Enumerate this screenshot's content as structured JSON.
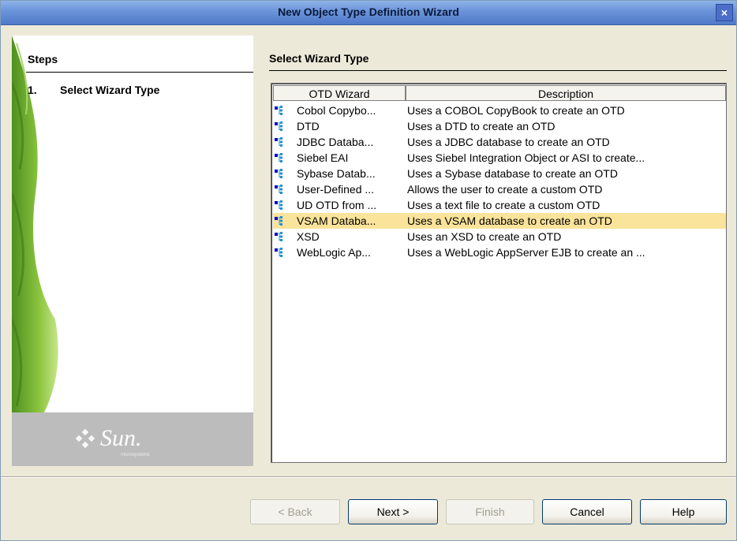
{
  "window": {
    "title": "New Object Type Definition Wizard",
    "close_glyph": "×"
  },
  "steps": {
    "title": "Steps",
    "items": [
      {
        "number": "1.",
        "label": "Select Wizard Type"
      }
    ]
  },
  "brand": {
    "name": "Sun.",
    "sub": "microsystems"
  },
  "main": {
    "title": "Select Wizard Type"
  },
  "table": {
    "columns": [
      "OTD Wizard",
      "Description"
    ],
    "rows": [
      {
        "name": "Cobol Copybo...",
        "description": "Uses a COBOL CopyBook to create an OTD"
      },
      {
        "name": "DTD",
        "description": "Uses a DTD to create an OTD"
      },
      {
        "name": "JDBC Databa...",
        "description": "Uses a JDBC database to create an OTD"
      },
      {
        "name": "Siebel EAI",
        "description": "Uses Siebel Integration Object or ASI to create..."
      },
      {
        "name": "Sybase Datab...",
        "description": "Uses a Sybase database to create an OTD"
      },
      {
        "name": "User-Defined ...",
        "description": "Allows the user to create a custom OTD"
      },
      {
        "name": "UD OTD from ...",
        "description": "Uses a text file to create a custom OTD"
      },
      {
        "name": "VSAM Databa...",
        "description": "Uses a VSAM database to create an OTD"
      },
      {
        "name": "XSD",
        "description": "Uses an XSD to create an OTD"
      },
      {
        "name": "WebLogic Ap...",
        "description": "Uses a WebLogic AppServer EJB to create an ..."
      }
    ],
    "selected_row": "VSAM Databa...",
    "row_icon": "otd-tree-icon"
  },
  "buttons": {
    "back": "< Back",
    "next": "Next >",
    "finish": "Finish",
    "cancel": "Cancel",
    "help": "Help"
  },
  "colors": {
    "title_bar": "#6d96db",
    "selection": "#fae39a",
    "brand_band": "#bcbcbc"
  }
}
